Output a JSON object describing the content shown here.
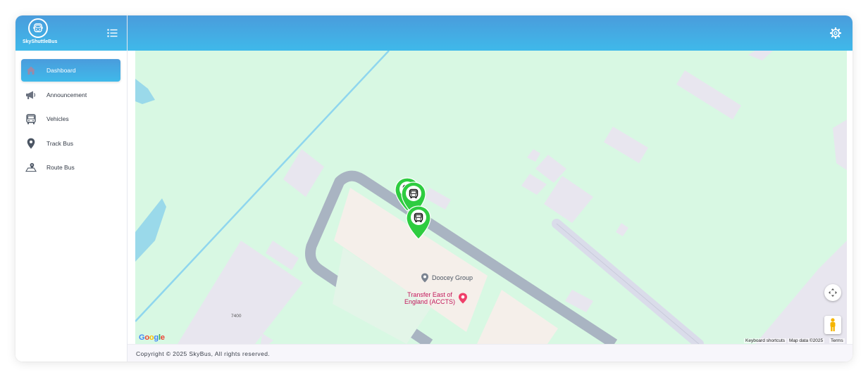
{
  "brand": {
    "name": "SkyShuttleBus",
    "logo_icon": "bus-face-icon"
  },
  "header": {
    "menu_icon": "menu-list-icon",
    "settings_icon": "gear-icon"
  },
  "sidebar": {
    "items": [
      {
        "label": "Dashboard",
        "icon": "home-icon",
        "active": true
      },
      {
        "label": "Announcement",
        "icon": "megaphone-icon",
        "active": false
      },
      {
        "label": "Vehicles",
        "icon": "bus-icon",
        "active": false
      },
      {
        "label": "Track Bus",
        "icon": "location-pin-icon",
        "active": false
      },
      {
        "label": "Route Bus",
        "icon": "map-route-icon",
        "active": false
      }
    ]
  },
  "map": {
    "pois": [
      {
        "name": "Doocey Group",
        "color": "#4b5563"
      },
      {
        "name_line1": "Transfer East of",
        "name_line2": "England (ACCTS)",
        "color": "#c2185b"
      }
    ],
    "building_number": "7400",
    "google_logo": "Google",
    "attribution": {
      "keyboard_shortcuts": "Keyboard shortcuts",
      "map_data": "Map data ©2025",
      "terms": "Terms"
    },
    "marker_color": "#2ecc40",
    "bus_markers": 3
  },
  "footer": {
    "copyright": "Copyright © 2025 SkyBus, All rights reserved."
  },
  "colors": {
    "accent_start": "#4a9cdc",
    "accent_end": "#3fb9ea",
    "map_bg": "#d8f8e3"
  }
}
